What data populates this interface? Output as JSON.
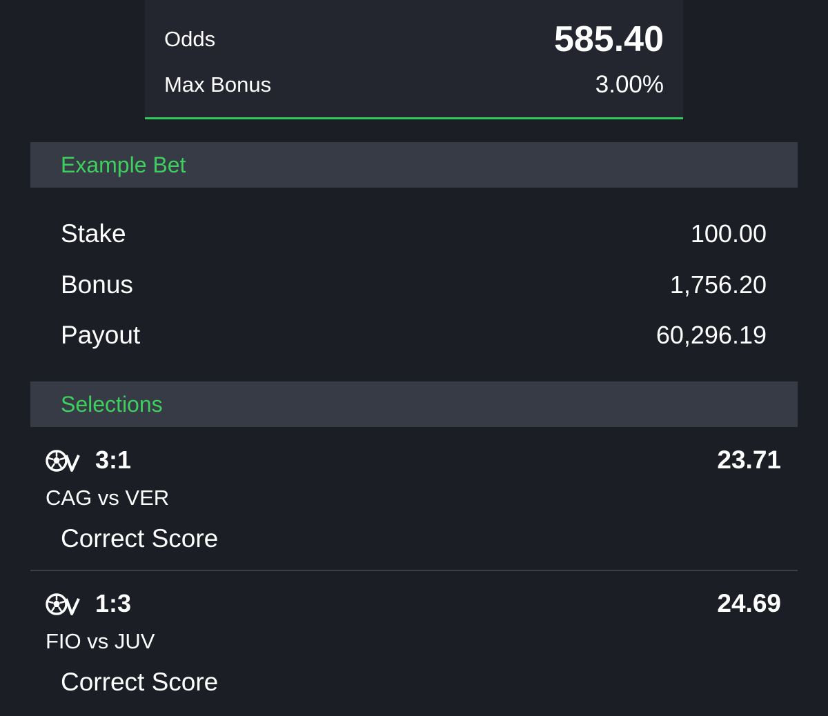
{
  "summary": {
    "odds_label": "Odds",
    "odds_value": "585.40",
    "max_bonus_label": "Max Bonus",
    "max_bonus_value": "3.00%"
  },
  "example_bet": {
    "header": "Example Bet",
    "rows": [
      {
        "label": "Stake",
        "value": "100.00"
      },
      {
        "label": "Bonus",
        "value": "1,756.20"
      },
      {
        "label": "Payout",
        "value": "60,296.19"
      }
    ]
  },
  "selections": {
    "header": "Selections",
    "items": [
      {
        "icon": "virtual-football-icon",
        "score": "3:1",
        "odds": "23.71",
        "match": "CAG vs VER",
        "market": "Correct Score"
      },
      {
        "icon": "virtual-football-icon",
        "score": "1:3",
        "odds": "24.69",
        "match": "FIO vs JUV",
        "market": "Correct Score"
      }
    ]
  },
  "colors": {
    "background": "#1b1e25",
    "card": "#23262e",
    "header_bg": "#363b46",
    "accent_green": "#3fcf5e"
  }
}
